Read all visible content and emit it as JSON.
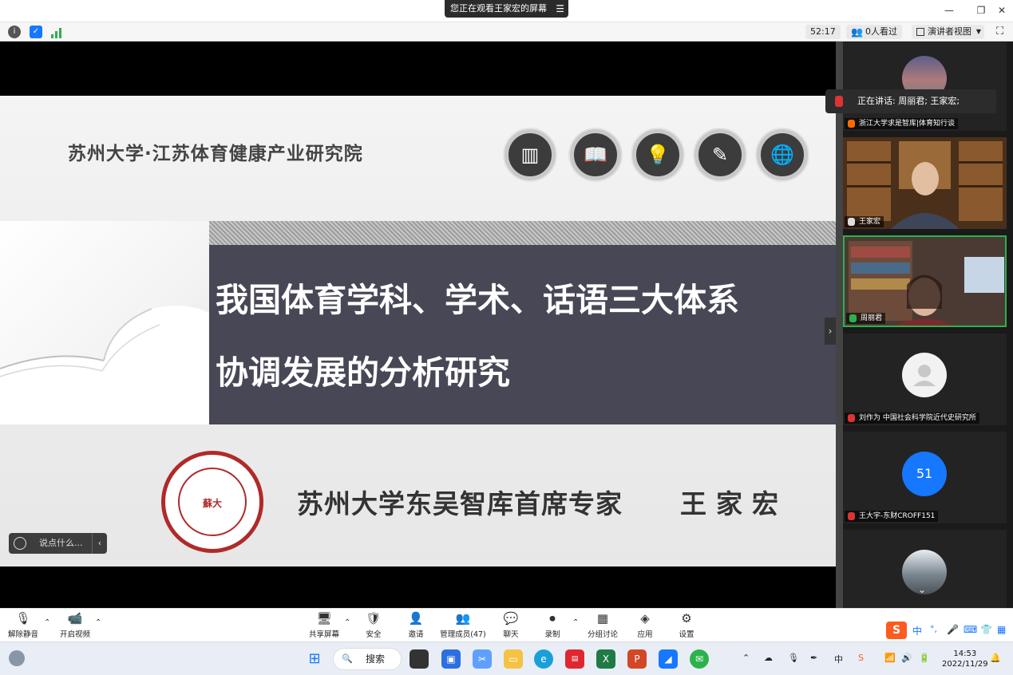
{
  "window": {
    "share_banner": "您正在观看王家宏的屏幕",
    "minimize": "—",
    "restore": "❐",
    "close": "✕"
  },
  "infobar": {
    "timer": "52:17",
    "viewers": "0人看过",
    "view_mode": "演讲者视图"
  },
  "slide": {
    "header": "苏州大学·江苏体育健康产业研究院",
    "title_line1": "我国体育学科、学术、话语三大体系",
    "title_line2": "协调发展的分析研究",
    "seal_text": "蘇大",
    "expert_title": "苏州大学东吴智库首席专家",
    "expert_name": "王家宏",
    "icons": [
      "books-icon",
      "open-book-icon",
      "lightbulb-icon",
      "notepad-icon",
      "globe-icon"
    ]
  },
  "chat_input": {
    "placeholder": "说点什么..."
  },
  "speaking": "正在讲话: 周丽君; 王家宏;",
  "participants": [
    {
      "name": "浙江大学求是智库|体育知行谈"
    },
    {
      "name": "王家宏"
    },
    {
      "name": "周丽君"
    },
    {
      "name": "刘作为 中国社会科学院近代史研究所"
    },
    {
      "name": "王大宇-东财CROFF151",
      "avatar_text": "51"
    }
  ],
  "toolbar": {
    "mute": "解除静音",
    "video": "开启视频",
    "share": "共享屏幕",
    "security": "安全",
    "invite": "邀请",
    "members": "管理成员(47)",
    "chat": "聊天",
    "record": "录制",
    "breakout": "分组讨论",
    "apps": "应用",
    "settings": "设置"
  },
  "taskbar": {
    "search": "搜索",
    "ime_lang": "中",
    "ime_mode": "中",
    "time": "14:53",
    "date": "2022/11/29"
  },
  "colors": {
    "title_box": "#474756",
    "seal_red": "#b02a2a",
    "accent_blue": "#1677ff"
  }
}
